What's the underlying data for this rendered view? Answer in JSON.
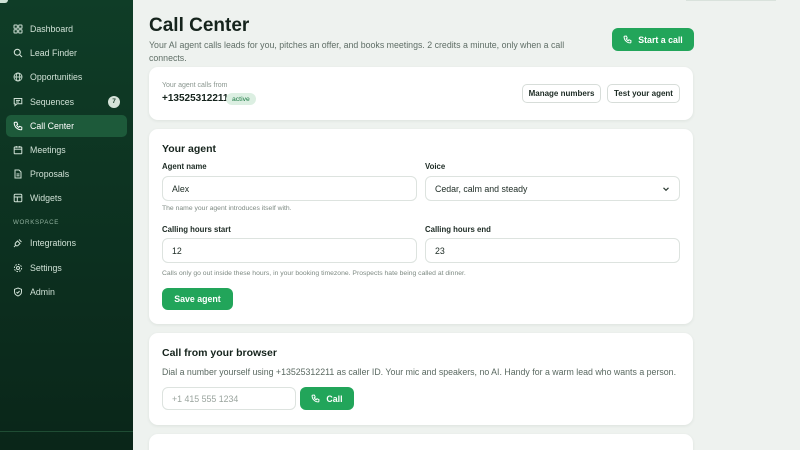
{
  "sidebar": {
    "items": [
      {
        "label": "Dashboard",
        "icon": "grid-icon"
      },
      {
        "label": "Lead Finder",
        "icon": "search-icon"
      },
      {
        "label": "Opportunities",
        "icon": "globe-icon"
      },
      {
        "label": "Sequences",
        "icon": "message-icon",
        "badge": "7"
      },
      {
        "label": "Call Center",
        "icon": "phone-icon",
        "active": true
      },
      {
        "label": "Meetings",
        "icon": "calendar-icon"
      },
      {
        "label": "Proposals",
        "icon": "document-icon"
      },
      {
        "label": "Widgets",
        "icon": "layers-icon"
      }
    ],
    "workspace_label": "WORKSPACE",
    "workspace_items": [
      {
        "label": "Integrations",
        "icon": "plug-icon"
      },
      {
        "label": "Settings",
        "icon": "gear-icon"
      },
      {
        "label": "Admin",
        "icon": "shield-icon"
      }
    ]
  },
  "header": {
    "title": "Call Center",
    "subtitle": "Your AI agent calls leads for you, pitches an offer, and books meetings. 2 credits a minute, only when a call connects.",
    "start_call_label": "Start a call"
  },
  "number_card": {
    "label": "Your agent calls from",
    "number": "+13525312211",
    "status": "active",
    "manage_label": "Manage numbers",
    "test_label": "Test your agent"
  },
  "agent_card": {
    "title": "Your agent",
    "name_label": "Agent name",
    "name_value": "Alex",
    "name_hint": "The name your agent introduces itself with.",
    "voice_label": "Voice",
    "voice_value": "Cedar, calm and steady",
    "start_label": "Calling hours start",
    "start_value": "12",
    "end_label": "Calling hours end",
    "end_value": "23",
    "hours_hint": "Calls only go out inside these hours, in your booking timezone. Prospects hate being called at dinner.",
    "save_label": "Save agent"
  },
  "browser_card": {
    "title": "Call from your browser",
    "description": "Dial a number yourself using +13525312211 as caller ID. Your mic and speakers, no AI. Handy for a warm lead who wants a person.",
    "placeholder": "+1 415 555 1234",
    "call_label": "Call"
  },
  "colors": {
    "accent": "#22a55a",
    "sidebar": "#0f3d27",
    "active_item": "#1d5a3a",
    "background": "#eef2ef"
  }
}
